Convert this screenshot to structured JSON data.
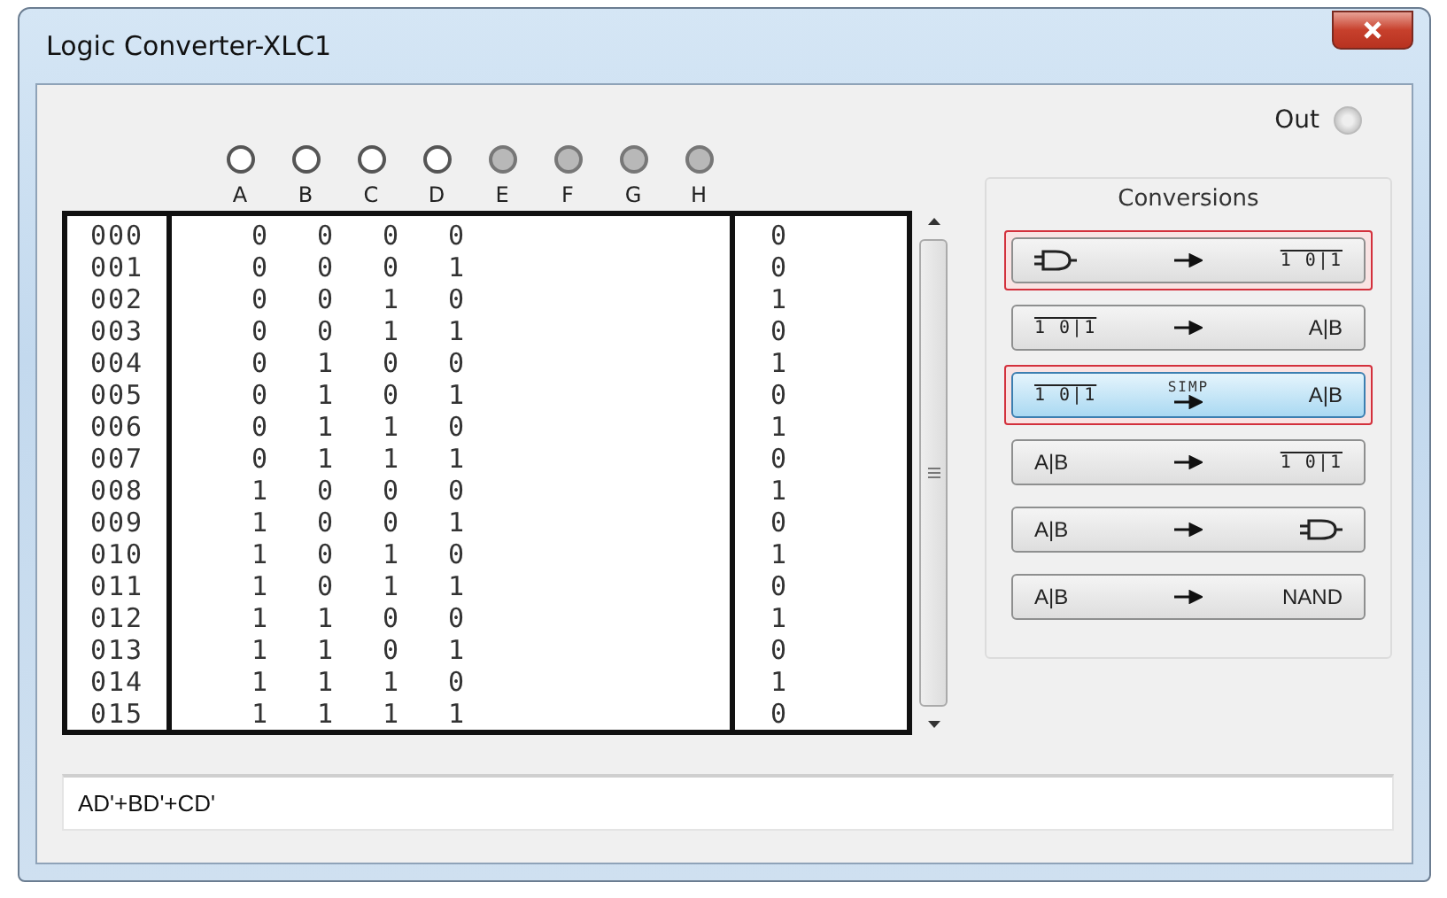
{
  "window": {
    "title": "Logic Converter-XLC1"
  },
  "out": {
    "label": "Out"
  },
  "inputs": [
    {
      "label": "A",
      "enabled": true
    },
    {
      "label": "B",
      "enabled": true
    },
    {
      "label": "C",
      "enabled": true
    },
    {
      "label": "D",
      "enabled": true
    },
    {
      "label": "E",
      "enabled": false
    },
    {
      "label": "F",
      "enabled": false
    },
    {
      "label": "G",
      "enabled": false
    },
    {
      "label": "H",
      "enabled": false
    }
  ],
  "truth_table": {
    "rows": [
      {
        "index": "000",
        "values": [
          "0",
          "0",
          "0",
          "0"
        ],
        "output": "0"
      },
      {
        "index": "001",
        "values": [
          "0",
          "0",
          "0",
          "1"
        ],
        "output": "0"
      },
      {
        "index": "002",
        "values": [
          "0",
          "0",
          "1",
          "0"
        ],
        "output": "1"
      },
      {
        "index": "003",
        "values": [
          "0",
          "0",
          "1",
          "1"
        ],
        "output": "0"
      },
      {
        "index": "004",
        "values": [
          "0",
          "1",
          "0",
          "0"
        ],
        "output": "1"
      },
      {
        "index": "005",
        "values": [
          "0",
          "1",
          "0",
          "1"
        ],
        "output": "0"
      },
      {
        "index": "006",
        "values": [
          "0",
          "1",
          "1",
          "0"
        ],
        "output": "1"
      },
      {
        "index": "007",
        "values": [
          "0",
          "1",
          "1",
          "1"
        ],
        "output": "0"
      },
      {
        "index": "008",
        "values": [
          "1",
          "0",
          "0",
          "0"
        ],
        "output": "1"
      },
      {
        "index": "009",
        "values": [
          "1",
          "0",
          "0",
          "1"
        ],
        "output": "0"
      },
      {
        "index": "010",
        "values": [
          "1",
          "0",
          "1",
          "0"
        ],
        "output": "1"
      },
      {
        "index": "011",
        "values": [
          "1",
          "0",
          "1",
          "1"
        ],
        "output": "0"
      },
      {
        "index": "012",
        "values": [
          "1",
          "1",
          "0",
          "0"
        ],
        "output": "1"
      },
      {
        "index": "013",
        "values": [
          "1",
          "1",
          "0",
          "1"
        ],
        "output": "0"
      },
      {
        "index": "014",
        "values": [
          "1",
          "1",
          "1",
          "0"
        ],
        "output": "1"
      },
      {
        "index": "015",
        "values": [
          "1",
          "1",
          "1",
          "1"
        ],
        "output": "0"
      }
    ]
  },
  "conversions": {
    "title": "Conversions",
    "buttons": [
      {
        "from": {
          "kind": "gate"
        },
        "to": {
          "kind": "table",
          "text": "1 0|1"
        },
        "highlighted": true,
        "selected": false
      },
      {
        "from": {
          "kind": "table",
          "text": "1 0|1"
        },
        "to": {
          "kind": "text",
          "text": "A|B"
        },
        "highlighted": false,
        "selected": false
      },
      {
        "from": {
          "kind": "table",
          "text": "1 0|1"
        },
        "via": "SIMP",
        "to": {
          "kind": "text",
          "text": "A|B"
        },
        "highlighted": true,
        "selected": true
      },
      {
        "from": {
          "kind": "text",
          "text": "A|B"
        },
        "to": {
          "kind": "table",
          "text": "1 0|1"
        },
        "highlighted": false,
        "selected": false
      },
      {
        "from": {
          "kind": "text",
          "text": "A|B"
        },
        "to": {
          "kind": "gate"
        },
        "highlighted": false,
        "selected": false
      },
      {
        "from": {
          "kind": "text",
          "text": "A|B"
        },
        "to": {
          "kind": "text",
          "text": "NAND"
        },
        "highlighted": false,
        "selected": false
      }
    ]
  },
  "expression": {
    "value": "AD'+BD'+CD'"
  }
}
